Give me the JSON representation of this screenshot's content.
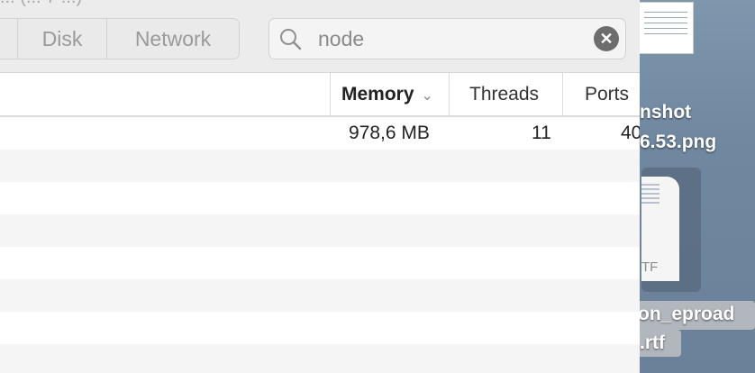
{
  "window": {
    "title_fragment": "... (... 7 ...)"
  },
  "toolbar": {
    "segments": [
      {
        "label": ""
      },
      {
        "label": "Disk"
      },
      {
        "label": "Network"
      }
    ],
    "search": {
      "value": "node",
      "placeholder": "Search"
    }
  },
  "table": {
    "columns": [
      {
        "label": "Memory",
        "sorted": true
      },
      {
        "label": "Threads"
      },
      {
        "label": "Ports"
      }
    ],
    "rows": [
      {
        "memory": "978,6 MB",
        "threads": "11",
        "ports": "40"
      }
    ],
    "empty_row_count": 7
  },
  "desktop": {
    "items": [
      {
        "label_line1": "nshot",
        "label_line2": "6.53.png"
      },
      {
        "label_line1": "on_eproad",
        "label_line2": ".rtf",
        "icon_ext": "TF"
      }
    ]
  }
}
